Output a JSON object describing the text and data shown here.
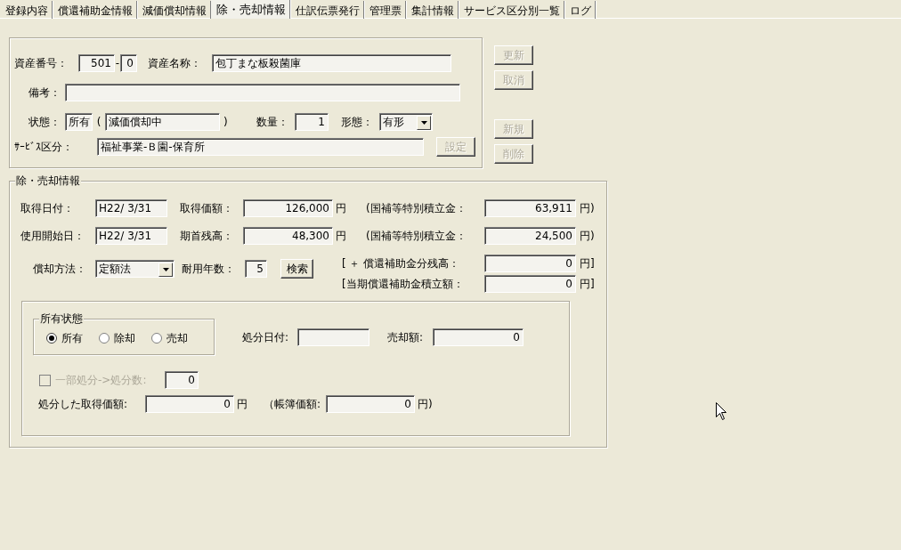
{
  "tabs": [
    {
      "label": "登録内容",
      "selected": false
    },
    {
      "label": "償還補助金情報",
      "selected": false
    },
    {
      "label": "減価償却情報",
      "selected": false
    },
    {
      "label": "除・売却情報",
      "selected": true
    },
    {
      "label": "仕訳伝票発行",
      "selected": false
    },
    {
      "label": "管理票",
      "selected": false
    },
    {
      "label": "集計情報",
      "selected": false
    },
    {
      "label": "サービス区分別一覧",
      "selected": false
    },
    {
      "label": "ログ",
      "selected": false
    }
  ],
  "asset": {
    "number_label": "資産番号：",
    "number": "501",
    "dash": "-",
    "branch": "0",
    "name_label": "資産名称：",
    "name": "包丁まな板殺菌庫",
    "notes_label": "備考：",
    "status_label": "状態：",
    "status": "所有",
    "paren_open": "(",
    "depreciation_status": "減価償却中",
    "paren_close": ")",
    "quantity_label": "数量：",
    "quantity": "1",
    "form_label": "形態：",
    "form": "有形",
    "service_label": "ｻｰﾋﾞｽ区分：",
    "service": "福祉事業-Ｂ園-保育所",
    "settings_button": {
      "label": "設定",
      "disabled": true
    }
  },
  "side_buttons": [
    {
      "label": "更新",
      "disabled": true
    },
    {
      "label": "取消",
      "disabled": true
    },
    {
      "label": "新規",
      "disabled": true
    },
    {
      "label": "削除",
      "disabled": true
    }
  ],
  "disposal": {
    "title": "除・売却情報",
    "acquisition_date_label": "取得日付：",
    "acquisition_date": "H22/ 3/31",
    "acquisition_cost_label": "取得価額：",
    "acquisition_cost": "126,000",
    "acquisition_cost_unit": "円",
    "subsidy_reserve_label": "(国補等特別積立金：",
    "subsidy_reserve": "63,911",
    "subsidy_reserve_unit": "円)",
    "start_date_label": "使用開始日：",
    "start_date": "H22/ 3/31",
    "opening_balance_label": "期首残高：",
    "opening_balance": "48,300",
    "opening_balance_unit": "円",
    "subsidy_reserve_label_2": "(国補等特別積立金：",
    "subsidy_reserve_2": "24,500",
    "subsidy_reserve_unit_2": "円)",
    "method_label": "償却方法：",
    "method": "定額法",
    "useful_life_label": "耐用年数：",
    "useful_life": "5",
    "search_button": "検索",
    "grant_balance_label": "[ ＋ 償還補助金分残高：",
    "grant_balance": "0",
    "grant_balance_unit": "円]",
    "grant_reserve_label": "[当期償還補助金積立額：",
    "grant_reserve": "0",
    "grant_reserve_unit": "円]",
    "ownership": {
      "title": "所有状態",
      "options": [
        {
          "label": "所有",
          "selected": true
        },
        {
          "label": "除却",
          "selected": false
        },
        {
          "label": "売却",
          "selected": false
        }
      ]
    },
    "disposal_date_label": "処分日付:",
    "sale_amount_label": "売却額:",
    "sale_amount": "0",
    "partial": {
      "label": "一部処分->処分数:",
      "checked": false,
      "disabled": true,
      "value": "0"
    },
    "disposed_cost_label": "処分した取得価額:",
    "disposed_cost": "0",
    "disposed_cost_unit": "円",
    "book_value_label": "（帳簿価額:",
    "book_value": "0",
    "book_value_unit": "円)"
  }
}
